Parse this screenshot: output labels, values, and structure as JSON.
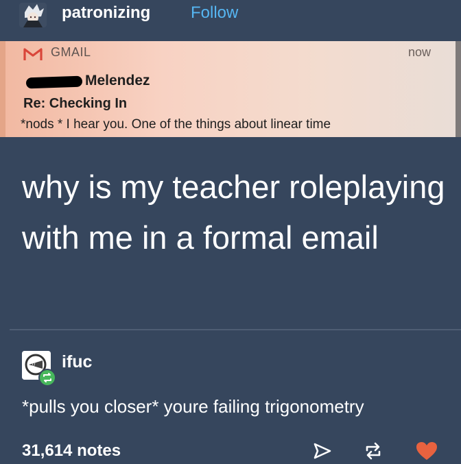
{
  "post": {
    "author": "patronizing",
    "follow_label": "Follow",
    "notification": {
      "app_name": "GMAIL",
      "time": "now",
      "sender": "Melendez",
      "subject": "Re: Checking In",
      "preview": "*nods * I hear you. One of the things about linear time"
    },
    "text": "why is my teacher roleplaying with me in a formal email"
  },
  "reblog": {
    "author": "ifuc",
    "text": "*pulls you closer* youre failing trigonometry"
  },
  "footer": {
    "notes": "31,614 notes",
    "icons": [
      "share-icon",
      "reblog-icon",
      "heart-icon"
    ]
  },
  "colors": {
    "background": "#36465d",
    "follow": "#56b6f2",
    "heart": "#e8623f",
    "reblog_badge": "#47b75c"
  }
}
